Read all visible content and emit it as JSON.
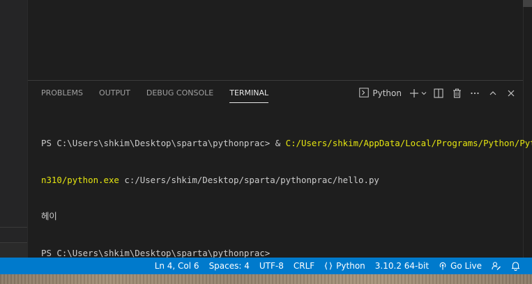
{
  "panel": {
    "tabs": [
      {
        "label": "PROBLEMS",
        "active": false
      },
      {
        "label": "OUTPUT",
        "active": false
      },
      {
        "label": "DEBUG CONSOLE",
        "active": false
      },
      {
        "label": "TERMINAL",
        "active": true
      }
    ],
    "terminal_name": "Python",
    "icons": {
      "terminal": "terminal-icon",
      "new": "plus-icon",
      "dropdown": "chevron-down-icon",
      "split": "split-icon",
      "kill": "trash-icon",
      "more": "ellipsis-icon",
      "maximize": "chevron-up-icon",
      "close": "close-icon"
    }
  },
  "terminal": {
    "lines": [
      {
        "prefix": "PS C:\\Users\\shkim\\Desktop\\sparta\\pythonprac> & ",
        "highlight": "C:/Users/shkim/AppData/Local/Programs/Python/Pytho"
      },
      {
        "prefix": "",
        "highlight": "n310/python.exe",
        "suffix": " c:/Users/shkim/Desktop/sparta/pythonprac/hello.py"
      },
      {
        "prefix": "헤이"
      },
      {
        "prefix": "PS C:\\Users\\shkim\\Desktop\\sparta\\pythonprac> "
      }
    ]
  },
  "status_bar": {
    "position": "Ln 4, Col 6",
    "spaces": "Spaces: 4",
    "encoding": "UTF-8",
    "eol": "CRLF",
    "language": "Python",
    "interpreter": "3.10.2 64-bit",
    "live": "Go Live",
    "icons": {
      "language": "braces-icon",
      "live": "broadcast-icon",
      "feedback": "feedback-icon",
      "notifications": "bell-icon"
    }
  },
  "colors": {
    "status_bar": "#007acc",
    "terminal_bg": "#1e1e1e",
    "highlight": "#e5e510",
    "text": "#cccccc"
  }
}
